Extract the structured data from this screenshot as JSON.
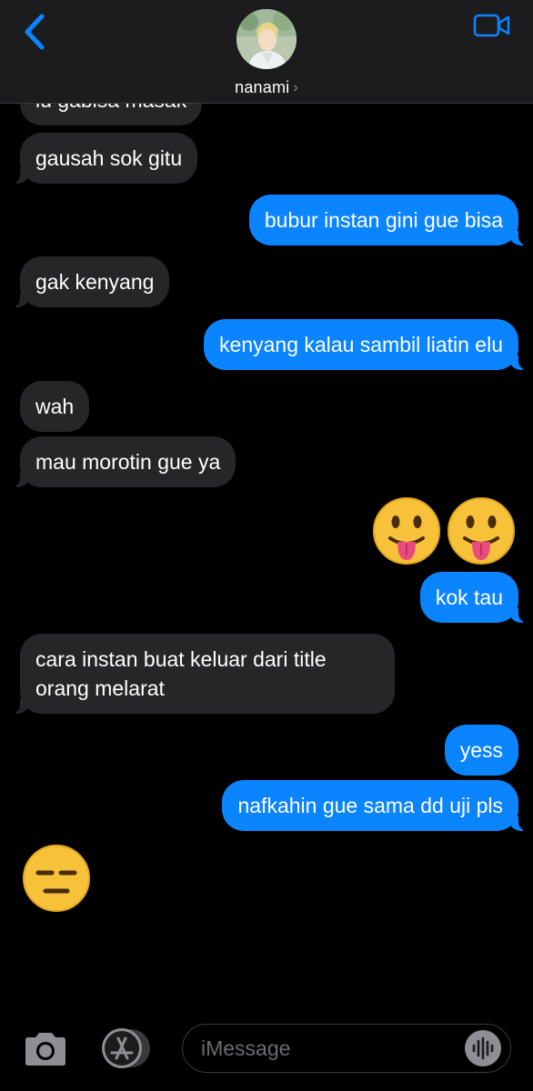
{
  "header": {
    "contact_name": "nanami",
    "back_icon": "chevron-left-icon",
    "video_icon": "video-camera-icon",
    "accent": "#0a84ff"
  },
  "messages": [
    {
      "side": "in",
      "text": "lu gabisa masak"
    },
    {
      "side": "in",
      "text": "gausah sok gitu"
    },
    {
      "side": "out",
      "text": "bubur instan gini gue bisa"
    },
    {
      "side": "in",
      "text": "gak kenyang"
    },
    {
      "side": "out",
      "text": "kenyang kalau sambil liatin elu"
    },
    {
      "side": "in",
      "text": "wah"
    },
    {
      "side": "in",
      "text": "mau morotin gue ya"
    },
    {
      "side": "out",
      "emoji": "😛😛"
    },
    {
      "side": "out",
      "text": "kok tau"
    },
    {
      "side": "in",
      "text": "cara instan buat keluar dari title orang melarat"
    },
    {
      "side": "out",
      "text": "yess"
    },
    {
      "side": "out",
      "text": "nafkahin gue sama dd uji pls"
    },
    {
      "side": "in",
      "emoji": "😑"
    }
  ],
  "composer": {
    "placeholder": "iMessage",
    "camera_icon": "camera-icon",
    "apps_icon": "app-store-icon",
    "audio_icon": "audio-waveform-icon"
  }
}
